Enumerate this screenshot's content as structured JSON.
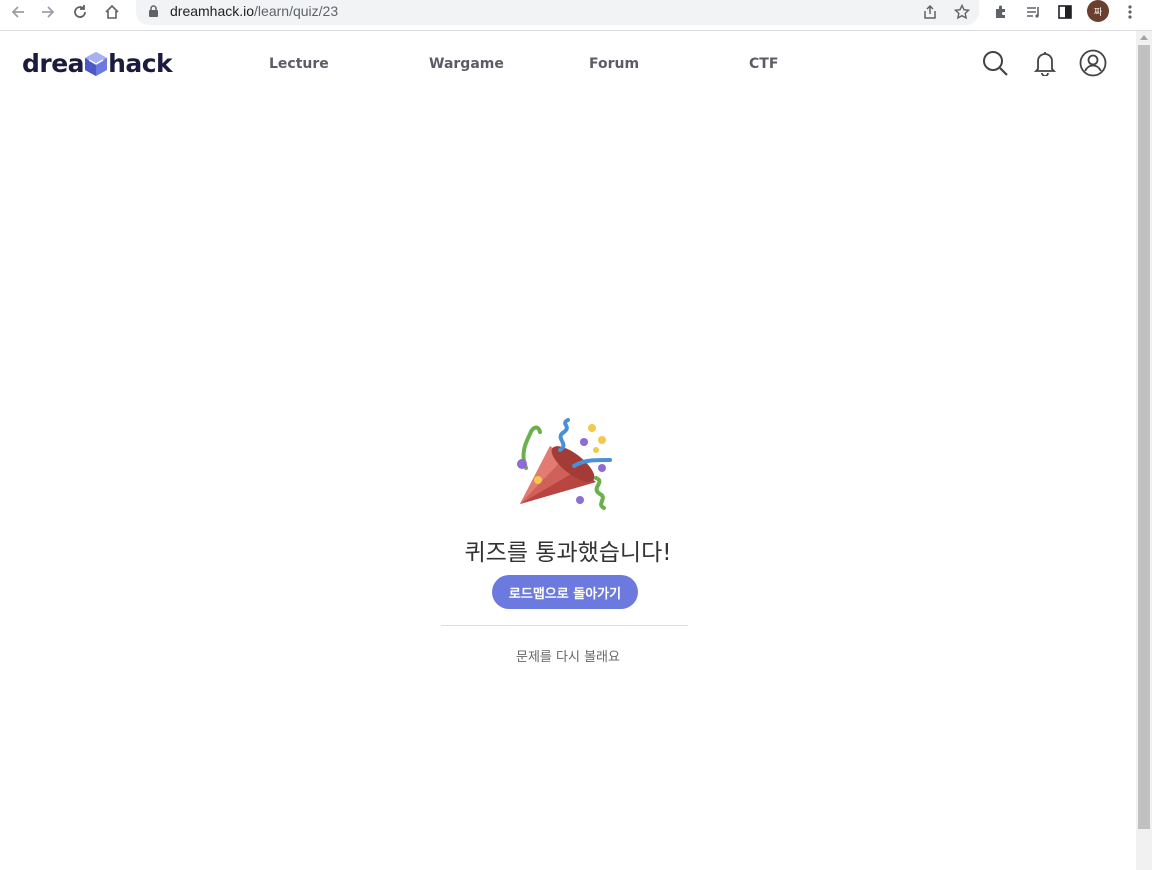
{
  "browser": {
    "url_host": "dreamhack.io",
    "url_path": "/learn/quiz/23",
    "profile_initial": "짜"
  },
  "header": {
    "logo_text_left": "drea",
    "logo_text_right": "hack",
    "nav": [
      "Lecture",
      "Wargame",
      "Forum",
      "CTF"
    ]
  },
  "main": {
    "title": "퀴즈를 통과했습니다!",
    "cta_label": "로드맵으로 돌아가기",
    "retry_label": "문제를 다시 볼래요"
  },
  "colors": {
    "accent": "#6c7ae0",
    "logo": "#1b1c3d"
  }
}
